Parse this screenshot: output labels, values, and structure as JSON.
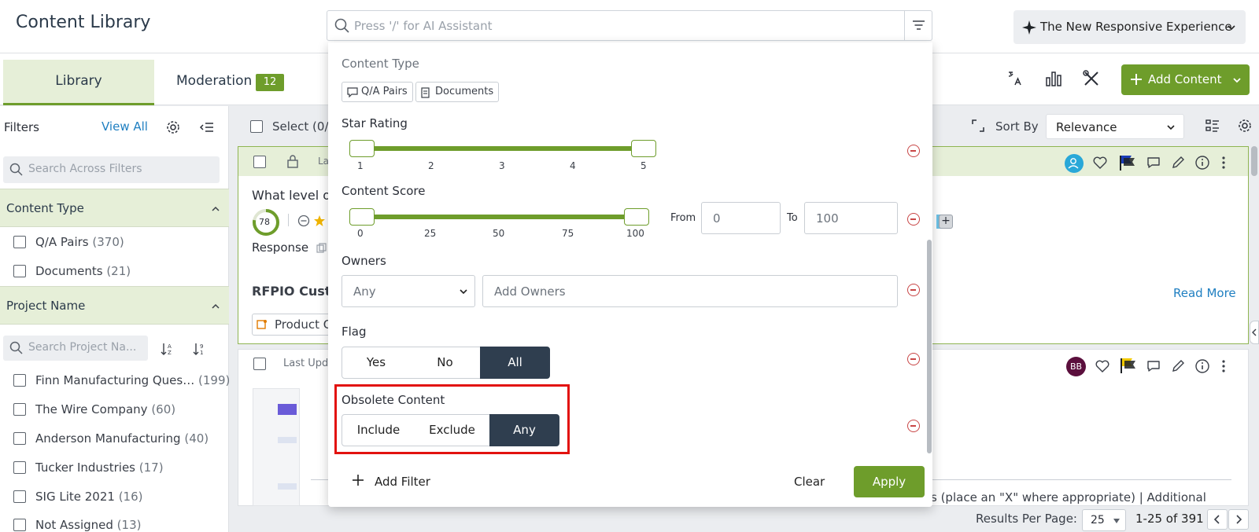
{
  "header": {
    "title": "Content Library",
    "search_placeholder": "Press '/' for AI Assistant",
    "experience_label": "The New Responsive Experience"
  },
  "tabs": {
    "library": "Library",
    "moderation": "Moderation",
    "moderation_count": "12"
  },
  "toolbar": {
    "add_content": "Add Content",
    "select_label": "Select (0/",
    "sort_by_label": "Sort By",
    "sort_value": "Relevance"
  },
  "left_panel": {
    "filters_label": "Filters",
    "view_all": "View All",
    "search_placeholder": "Search Across Filters",
    "content_type": {
      "title": "Content Type",
      "items": [
        {
          "label": "Q/A Pairs",
          "count": "(370)"
        },
        {
          "label": "Documents",
          "count": "(21)"
        }
      ]
    },
    "project_name": {
      "title": "Project Name",
      "search_placeholder": "Search Project Na...",
      "items": [
        {
          "label": "Finn Manufacturing Ques…",
          "count": "(199)"
        },
        {
          "label": "The Wire Company",
          "count": "(60)"
        },
        {
          "label": "Anderson Manufacturing",
          "count": "(40)"
        },
        {
          "label": "Tucker Industries",
          "count": "(17)"
        },
        {
          "label": "SIG Lite 2021",
          "count": "(16)"
        },
        {
          "label": "Not Assigned",
          "count": "(13)"
        }
      ]
    }
  },
  "cards": {
    "card1_lock_text": "La",
    "card1_question": "What level o",
    "card1_score": "78",
    "card1_response": "Response",
    "card1_rfpio": "RFPIO Custo",
    "card1_tag": "Product C",
    "read_more": "Read More",
    "card2_last_updated": "Last Upda",
    "card2_avatar": "BB",
    "card2_snippet": "s (place an \"X\" where appropriate) | Additional"
  },
  "pagination": {
    "results_per_page_label": "Results Per Page:",
    "per_page": "25",
    "range": "1-25 of 391"
  },
  "filter_dropdown": {
    "content_type_label": "Content Type",
    "chip_qa": "Q/A Pairs",
    "chip_docs": "Documents",
    "star_rating_label": "Star Rating",
    "star_ticks": [
      "1",
      "2",
      "3",
      "4",
      "5"
    ],
    "star_range": [
      1,
      5
    ],
    "content_score_label": "Content Score",
    "score_ticks": [
      "0",
      "25",
      "50",
      "75",
      "100"
    ],
    "score_range": [
      0,
      100
    ],
    "from_label": "From",
    "from_value": "0",
    "to_label": "To",
    "to_value": "100",
    "owners_label": "Owners",
    "owners_select": "Any",
    "owners_placeholder": "Add Owners",
    "flag_label": "Flag",
    "flag_options": [
      "Yes",
      "No",
      "All"
    ],
    "flag_selected": "All",
    "obsolete_label": "Obsolete Content",
    "obsolete_options": [
      "Include",
      "Exclude",
      "Any"
    ],
    "obsolete_selected": "Any",
    "add_filter": "Add Filter",
    "clear": "Clear",
    "apply": "Apply"
  },
  "colors": {
    "accent_green": "#6e9d2b",
    "highlight_red": "#e2120f",
    "dark_segment": "#2f3e4f",
    "link_blue": "#1f7fc1"
  }
}
